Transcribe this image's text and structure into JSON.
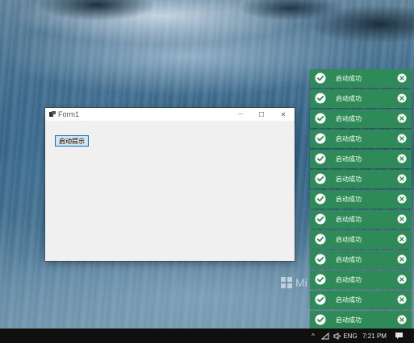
{
  "window": {
    "title": "Form1",
    "button_label": "启动提示",
    "minimize_label": "─",
    "maximize_label": "☐",
    "close_label": "✕"
  },
  "toasts": [
    {
      "message": "启动成功"
    },
    {
      "message": "启动成功"
    },
    {
      "message": "启动成功"
    },
    {
      "message": "启动成功"
    },
    {
      "message": "启动成功"
    },
    {
      "message": "启动成功"
    },
    {
      "message": "启动成功"
    },
    {
      "message": "启动成功"
    },
    {
      "message": "启动成功"
    },
    {
      "message": "启动成功"
    },
    {
      "message": "启动成功"
    },
    {
      "message": "启动成功"
    },
    {
      "message": "启动成功"
    }
  ],
  "desktop": {
    "watermark": "Mi"
  },
  "taskbar": {
    "chevron": "^",
    "language": "ENG",
    "time": "7:21 PM"
  },
  "colors": {
    "toast_background": "#2e8b57",
    "taskbar_background": "#101010",
    "window_background": "#f0f0f0",
    "button_border": "#0078d7"
  },
  "icons": {
    "toast_status": "check-circle-icon",
    "toast_close": "close-circle-icon",
    "tray": [
      "chevron-up-icon",
      "network-icon",
      "volume-icon",
      "notification-icon"
    ]
  }
}
